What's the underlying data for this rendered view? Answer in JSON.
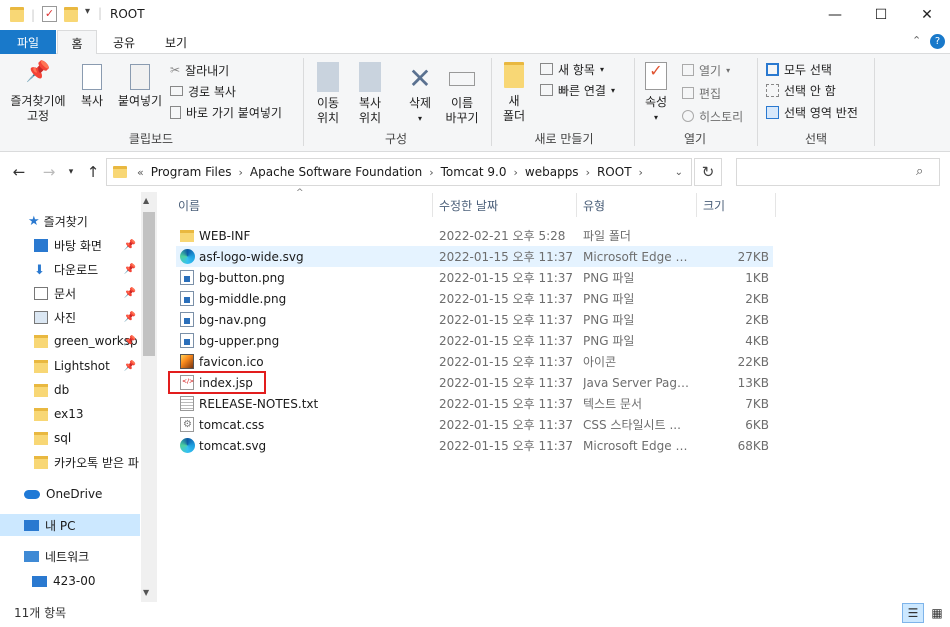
{
  "window": {
    "title": "ROOT",
    "controls": {
      "minimize": "—",
      "maximize": "☐",
      "close": "✕"
    }
  },
  "ribbon": {
    "tabs": [
      "파일",
      "홈",
      "공유",
      "보기"
    ],
    "groups": {
      "clipboard": {
        "label": "클립보드",
        "pin": "즐겨찾기에\n고정",
        "copy": "복사",
        "paste": "붙여넣기",
        "cut": "잘라내기",
        "copy_path": "경로 복사",
        "paste_shortcut": "바로 가기 붙여넣기"
      },
      "organize": {
        "label": "구성",
        "move_to": "이동\n위치",
        "copy_to": "복사\n위치",
        "delete": "삭제",
        "rename": "이름\n바꾸기"
      },
      "new": {
        "label": "새로 만들기",
        "new_folder": "새\n폴더",
        "new_item": "새 항목",
        "easy_access": "빠른 연결"
      },
      "open": {
        "label": "열기",
        "properties": "속성",
        "open": "열기",
        "edit": "편집",
        "history": "히스토리"
      },
      "select": {
        "label": "선택",
        "select_all": "모두 선택",
        "select_none": "선택 안 함",
        "invert": "선택 영역 반전"
      }
    }
  },
  "address": {
    "prefix": "«",
    "crumbs": [
      "Program Files",
      "Apache Software Foundation",
      "Tomcat 9.0",
      "webapps",
      "ROOT"
    ],
    "search_placeholder": ""
  },
  "nav": {
    "quick_access": "즐겨찾기",
    "items": [
      {
        "label": "바탕 화면",
        "icon": "desktop-icon",
        "pinned": true
      },
      {
        "label": "다운로드",
        "icon": "download-icon",
        "pinned": true
      },
      {
        "label": "문서",
        "icon": "document-icon",
        "pinned": true
      },
      {
        "label": "사진",
        "icon": "picture-icon",
        "pinned": true
      },
      {
        "label": "green_worksp",
        "icon": "folder-icon",
        "pinned": true
      },
      {
        "label": "Lightshot",
        "icon": "folder-icon",
        "pinned": true
      },
      {
        "label": "db",
        "icon": "folder-icon",
        "pinned": false
      },
      {
        "label": "ex13",
        "icon": "folder-icon",
        "pinned": false
      },
      {
        "label": "sql",
        "icon": "folder-icon",
        "pinned": false
      },
      {
        "label": "카카오톡 받은 파",
        "icon": "folder-icon",
        "pinned": false
      }
    ],
    "onedrive": "OneDrive",
    "this_pc": "내 PC",
    "network": "네트워크",
    "network_child": "423-00"
  },
  "list": {
    "columns": {
      "name": "이름",
      "date": "수정한 날짜",
      "type": "유형",
      "size": "크기"
    },
    "files": [
      {
        "name": "WEB-INF",
        "date": "2022-02-21 오후 5:28",
        "type": "파일 폴더",
        "size": "",
        "icon": "folder"
      },
      {
        "name": "asf-logo-wide.svg",
        "date": "2022-01-15 오후 11:37",
        "type": "Microsoft Edge H...",
        "size": "27KB",
        "icon": "edge"
      },
      {
        "name": "bg-button.png",
        "date": "2022-01-15 오후 11:37",
        "type": "PNG 파일",
        "size": "1KB",
        "icon": "png"
      },
      {
        "name": "bg-middle.png",
        "date": "2022-01-15 오후 11:37",
        "type": "PNG 파일",
        "size": "2KB",
        "icon": "png"
      },
      {
        "name": "bg-nav.png",
        "date": "2022-01-15 오후 11:37",
        "type": "PNG 파일",
        "size": "2KB",
        "icon": "png"
      },
      {
        "name": "bg-upper.png",
        "date": "2022-01-15 오후 11:37",
        "type": "PNG 파일",
        "size": "4KB",
        "icon": "png"
      },
      {
        "name": "favicon.ico",
        "date": "2022-01-15 오후 11:37",
        "type": "아이콘",
        "size": "22KB",
        "icon": "ico"
      },
      {
        "name": "index.jsp",
        "date": "2022-01-15 오후 11:37",
        "type": "Java Server Pages...",
        "size": "13KB",
        "icon": "doc"
      },
      {
        "name": "RELEASE-NOTES.txt",
        "date": "2022-01-15 오후 11:37",
        "type": "텍스트 문서",
        "size": "7KB",
        "icon": "txt"
      },
      {
        "name": "tomcat.css",
        "date": "2022-01-15 오후 11:37",
        "type": "CSS 스타일시트 ...",
        "size": "6KB",
        "icon": "css"
      },
      {
        "name": "tomcat.svg",
        "date": "2022-01-15 오후 11:37",
        "type": "Microsoft Edge H...",
        "size": "68KB",
        "icon": "edge"
      }
    ]
  },
  "status": {
    "count": "11개 항목"
  },
  "colors": {
    "accent": "#1979ca",
    "highlight_box": "#e21d1d",
    "row_hover": "#e5f3ff",
    "selected_nav": "#cce8ff"
  }
}
